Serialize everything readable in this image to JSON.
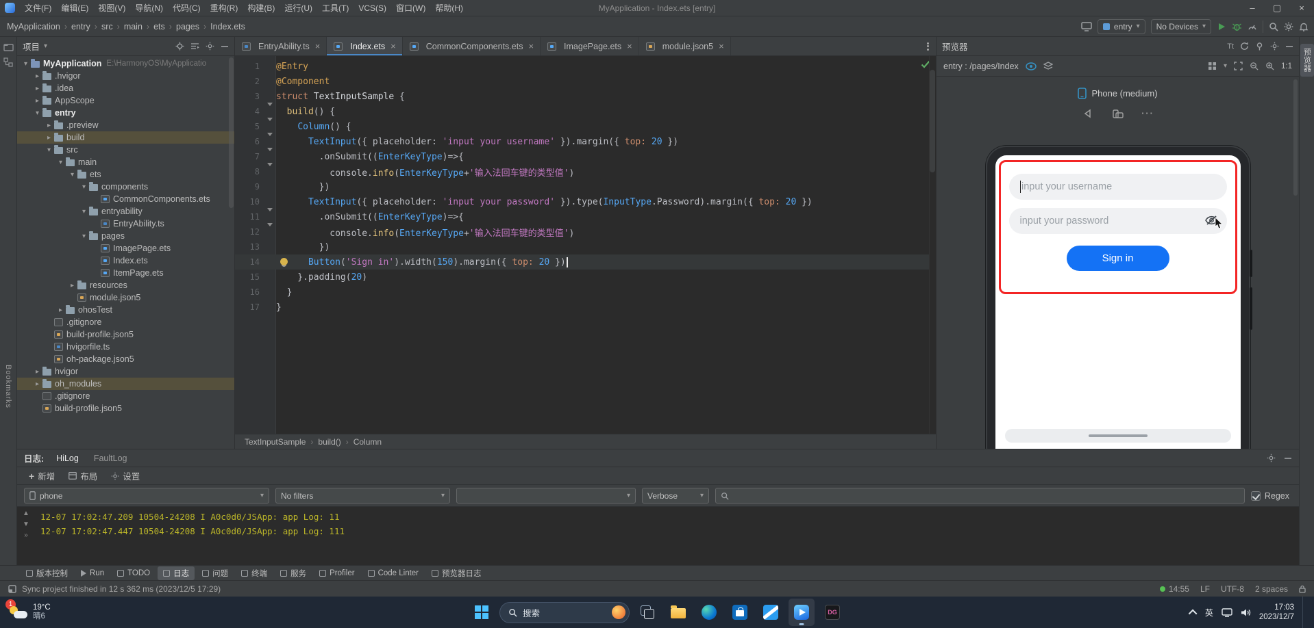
{
  "colors": {
    "accent": "#4a88c7",
    "run_green": "#499c54",
    "highlight_red": "#f32525",
    "harmony_blue": "#1472f5",
    "log_yellow": "#bbb529"
  },
  "titlebar": {
    "menus": [
      "文件(F)",
      "编辑(E)",
      "视图(V)",
      "导航(N)",
      "代码(C)",
      "重构(R)",
      "构建(B)",
      "运行(U)",
      "工具(T)",
      "VCS(S)",
      "窗口(W)",
      "帮助(H)"
    ],
    "title": "MyApplication - Index.ets [entry]"
  },
  "toolbar": {
    "breadcrumbs": [
      "MyApplication",
      "entry",
      "src",
      "main",
      "ets",
      "pages",
      "Index.ets"
    ],
    "module_select": "entry",
    "device_select": "No Devices"
  },
  "strips": {
    "left_label": "Bookmarks",
    "right_label": "预览器"
  },
  "project": {
    "panel_title": "项目",
    "tree": [
      {
        "label": "MyApplication",
        "extra": "E:\\HarmonyOS\\MyApplicatio",
        "depth": 0,
        "icon": "project",
        "chev": "open",
        "bold": true
      },
      {
        "label": ".hvigor",
        "depth": 1,
        "icon": "folder",
        "chev": "closed"
      },
      {
        "label": ".idea",
        "depth": 1,
        "icon": "folder",
        "chev": "closed"
      },
      {
        "label": "AppScope",
        "depth": 1,
        "icon": "folder",
        "chev": "closed"
      },
      {
        "label": "entry",
        "depth": 1,
        "icon": "module",
        "chev": "open",
        "bold": true
      },
      {
        "label": ".preview",
        "depth": 2,
        "icon": "folder",
        "chev": "closed"
      },
      {
        "label": "build",
        "depth": 2,
        "icon": "folder",
        "chev": "closed",
        "sel": true
      },
      {
        "label": "src",
        "depth": 2,
        "icon": "folder",
        "chev": "open"
      },
      {
        "label": "main",
        "depth": 3,
        "icon": "folder",
        "chev": "open"
      },
      {
        "label": "ets",
        "depth": 4,
        "icon": "folder",
        "chev": "open"
      },
      {
        "label": "components",
        "depth": 5,
        "icon": "folder",
        "chev": "open"
      },
      {
        "label": "CommonComponents.ets",
        "depth": 6,
        "icon": "ets",
        "chev": "none"
      },
      {
        "label": "entryability",
        "depth": 5,
        "icon": "folder",
        "chev": "open"
      },
      {
        "label": "EntryAbility.ts",
        "depth": 6,
        "icon": "ts",
        "chev": "none"
      },
      {
        "label": "pages",
        "depth": 5,
        "icon": "folder",
        "chev": "open"
      },
      {
        "label": "ImagePage.ets",
        "depth": 6,
        "icon": "ets",
        "chev": "none"
      },
      {
        "label": "Index.ets",
        "depth": 6,
        "icon": "ets",
        "chev": "none"
      },
      {
        "label": "ItemPage.ets",
        "depth": 6,
        "icon": "ets",
        "chev": "none"
      },
      {
        "label": "resources",
        "depth": 4,
        "icon": "folder",
        "chev": "closed"
      },
      {
        "label": "module.json5",
        "depth": 4,
        "icon": "json",
        "chev": "none"
      },
      {
        "label": "ohosTest",
        "depth": 3,
        "icon": "folder",
        "chev": "closed"
      },
      {
        "label": ".gitignore",
        "depth": 2,
        "icon": "file",
        "chev": "none"
      },
      {
        "label": "build-profile.json5",
        "depth": 2,
        "icon": "json",
        "chev": "none"
      },
      {
        "label": "hvigorfile.ts",
        "depth": 2,
        "icon": "ts",
        "chev": "none"
      },
      {
        "label": "oh-package.json5",
        "depth": 2,
        "icon": "json",
        "chev": "none"
      },
      {
        "label": "hvigor",
        "depth": 1,
        "icon": "folder",
        "chev": "closed"
      },
      {
        "label": "oh_modules",
        "depth": 1,
        "icon": "folder",
        "chev": "closed",
        "sel": true
      },
      {
        "label": ".gitignore",
        "depth": 1,
        "icon": "file",
        "chev": "none"
      },
      {
        "label": "build-profile.json5",
        "depth": 1,
        "icon": "json",
        "chev": "none"
      }
    ]
  },
  "editor": {
    "tabs": [
      {
        "label": "EntryAbility.ts",
        "icon": "ts"
      },
      {
        "label": "Index.ets",
        "icon": "ets",
        "active": true
      },
      {
        "label": "CommonComponents.ets",
        "icon": "ets"
      },
      {
        "label": "ImagePage.ets",
        "icon": "ets"
      },
      {
        "label": "module.json5",
        "icon": "json"
      }
    ],
    "breadcrumb": [
      "TextInputSample",
      "build()",
      "Column"
    ],
    "code": {
      "lines": [
        {
          "n": 1,
          "tokens": [
            [
              "ann",
              "@Entry"
            ]
          ]
        },
        {
          "n": 2,
          "tokens": [
            [
              "ann",
              "@Component"
            ]
          ]
        },
        {
          "n": 3,
          "fold": true,
          "tokens": [
            [
              "kw",
              "struct "
            ],
            [
              "decl",
              "TextInputSample "
            ],
            [
              "pl",
              "{"
            ]
          ]
        },
        {
          "n": 4,
          "fold": true,
          "tokens": [
            [
              "pl",
              "  "
            ],
            [
              "fn",
              "build"
            ],
            [
              "pl",
              "() {"
            ]
          ]
        },
        {
          "n": 5,
          "fold": true,
          "tokens": [
            [
              "pl",
              "    "
            ],
            [
              "cls",
              "Column"
            ],
            [
              "pl",
              "() {"
            ]
          ]
        },
        {
          "n": 6,
          "fold": true,
          "tokens": [
            [
              "pl",
              "      "
            ],
            [
              "cls",
              "TextInput"
            ],
            [
              "pl",
              "({ placeholder: "
            ],
            [
              "str",
              "'input your username'"
            ],
            [
              "pl",
              " }).margin({ "
            ],
            [
              "kw",
              "top:"
            ],
            [
              "pl",
              " "
            ],
            [
              "num",
              "20"
            ],
            [
              "pl",
              " })"
            ]
          ]
        },
        {
          "n": 7,
          "fold": true,
          "tokens": [
            [
              "pl",
              "        .onSubmit(("
            ],
            [
              "cls",
              "EnterKeyType"
            ],
            [
              "pl",
              ")=>{"
            ]
          ]
        },
        {
          "n": 8,
          "tokens": [
            [
              "pl",
              "          console."
            ],
            [
              "fn",
              "info"
            ],
            [
              "pl",
              "("
            ],
            [
              "cls",
              "EnterKeyType"
            ],
            [
              "pl",
              "+"
            ],
            [
              "str",
              "'输入法回车键的类型值'"
            ],
            [
              "pl",
              ")"
            ]
          ]
        },
        {
          "n": 9,
          "tokens": [
            [
              "pl",
              "        })"
            ]
          ]
        },
        {
          "n": 10,
          "fold": true,
          "tokens": [
            [
              "pl",
              "      "
            ],
            [
              "cls",
              "TextInput"
            ],
            [
              "pl",
              "({ placeholder: "
            ],
            [
              "str",
              "'input your password'"
            ],
            [
              "pl",
              " }).type("
            ],
            [
              "cls",
              "InputType"
            ],
            [
              "pl",
              ".Password).margin({ "
            ],
            [
              "kw",
              "top:"
            ],
            [
              "pl",
              " "
            ],
            [
              "num",
              "20"
            ],
            [
              "pl",
              " })"
            ]
          ]
        },
        {
          "n": 11,
          "fold": true,
          "tokens": [
            [
              "pl",
              "        .onSubmit(("
            ],
            [
              "cls",
              "EnterKeyType"
            ],
            [
              "pl",
              ")=>{"
            ]
          ]
        },
        {
          "n": 12,
          "tokens": [
            [
              "pl",
              "          console."
            ],
            [
              "fn",
              "info"
            ],
            [
              "pl",
              "("
            ],
            [
              "cls",
              "EnterKeyType"
            ],
            [
              "pl",
              "+"
            ],
            [
              "str",
              "'输入法回车键的类型值'"
            ],
            [
              "pl",
              ")"
            ]
          ]
        },
        {
          "n": 13,
          "tokens": [
            [
              "pl",
              "        })"
            ]
          ]
        },
        {
          "n": 14,
          "caret": true,
          "bulb": true,
          "tokens": [
            [
              "pl",
              "      "
            ],
            [
              "cls",
              "Button"
            ],
            [
              "pl",
              "("
            ],
            [
              "str",
              "'Sign in'"
            ],
            [
              "pl",
              ").width("
            ],
            [
              "num",
              "150"
            ],
            [
              "pl",
              ").margin({ "
            ],
            [
              "kw",
              "top:"
            ],
            [
              "pl",
              " "
            ],
            [
              "num",
              "20"
            ],
            [
              "pl",
              " })"
            ]
          ]
        },
        {
          "n": 15,
          "tokens": [
            [
              "pl",
              "    }.padding("
            ],
            [
              "num",
              "20"
            ],
            [
              "pl",
              ")"
            ]
          ]
        },
        {
          "n": 16,
          "tokens": [
            [
              "pl",
              "  }"
            ]
          ]
        },
        {
          "n": 17,
          "tokens": [
            [
              "pl",
              "}"
            ]
          ]
        }
      ]
    }
  },
  "previewer": {
    "title": "预览器",
    "route": "entry : /pages/Index",
    "device_label": "Phone (medium)",
    "zoom": "1:1",
    "phone": {
      "username_placeholder": "input your username",
      "password_placeholder": "input your password",
      "signin_label": "Sign in"
    }
  },
  "hilog": {
    "label": "日志:",
    "tabs": [
      "HiLog",
      "FaultLog"
    ],
    "actions": [
      "新增",
      "布局",
      "设置"
    ],
    "filters": {
      "device": "phone",
      "filter": "No filters",
      "custom": "",
      "level": "Verbose",
      "regex_label": "Regex"
    },
    "lines": [
      "12-07 17:02:47.209 10504-24208 I A0c0d0/JSApp: app Log: 11",
      "12-07 17:02:47.447 10504-24208 I A0c0d0/JSApp: app Log: 111"
    ]
  },
  "toolwindows": {
    "items": [
      {
        "label": "版本控制",
        "icon": "vcs"
      },
      {
        "label": "Run",
        "icon": "run"
      },
      {
        "label": "TODO",
        "icon": "todo"
      },
      {
        "label": "日志",
        "icon": "log",
        "active": true
      },
      {
        "label": "问题",
        "icon": "problems"
      },
      {
        "label": "终端",
        "icon": "terminal"
      },
      {
        "label": "服务",
        "icon": "services"
      },
      {
        "label": "Profiler",
        "icon": "profiler"
      },
      {
        "label": "Code Linter",
        "icon": "linter"
      },
      {
        "label": "预览器日志",
        "icon": "previewer-log"
      }
    ]
  },
  "statusbar": {
    "message": "Sync project finished in 12 s 362 ms (2023/12/5 17:29)",
    "time": "14:55",
    "line_ending": "LF",
    "encoding": "UTF-8",
    "indent": "2 spaces"
  },
  "taskbar": {
    "weather_temp": "19°C",
    "weather_desc": "晴6",
    "badge": "1",
    "search_placeholder": "搜索",
    "dg_label": "DG",
    "lang": "英",
    "time": "17:03",
    "date": "2023/12/7"
  }
}
